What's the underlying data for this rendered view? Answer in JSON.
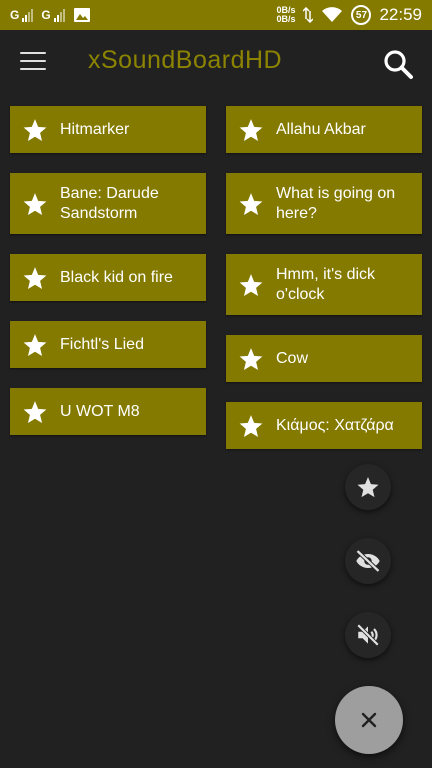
{
  "status_bar": {
    "sim1_label": "G",
    "sim2_label": "G",
    "net_up": "0B/s",
    "net_down": "0B/s",
    "battery": "57",
    "time": "22:59",
    "icons": [
      "signal-icon",
      "signal-icon",
      "image-icon",
      "data-arrows-icon",
      "wifi-icon",
      "battery-icon"
    ]
  },
  "app_bar": {
    "title": "xSoundBoardHD",
    "menu_icon": "hamburger-menu-icon",
    "search_icon": "search-icon"
  },
  "sounds": {
    "left": [
      {
        "label": "Hitmarker",
        "icon": "star-icon"
      },
      {
        "label": "Bane: Darude Sandstorm",
        "icon": "star-icon"
      },
      {
        "label": "Black kid on fire",
        "icon": "star-icon"
      },
      {
        "label": "Fichtl's Lied",
        "icon": "star-icon"
      },
      {
        "label": "U WOT M8",
        "icon": "star-icon"
      }
    ],
    "right": [
      {
        "label": "Allahu Akbar",
        "icon": "star-icon"
      },
      {
        "label": "What is going on here?",
        "icon": "star-icon"
      },
      {
        "label": "Hmm, it's dick o'clock",
        "icon": "star-icon"
      },
      {
        "label": "Cow",
        "icon": "star-icon"
      },
      {
        "label": "Κιάμος: Χατζάρα",
        "icon": "star-icon"
      }
    ]
  },
  "fab_menu": {
    "favorites_icon": "star-icon",
    "hide_icon": "eye-off-icon",
    "mute_icon": "volume-off-icon",
    "close_icon": "close-icon"
  },
  "colors": {
    "accent": "#847a00",
    "title": "#8c8400",
    "background": "#212121",
    "fab_main": "#9e9e9e"
  }
}
